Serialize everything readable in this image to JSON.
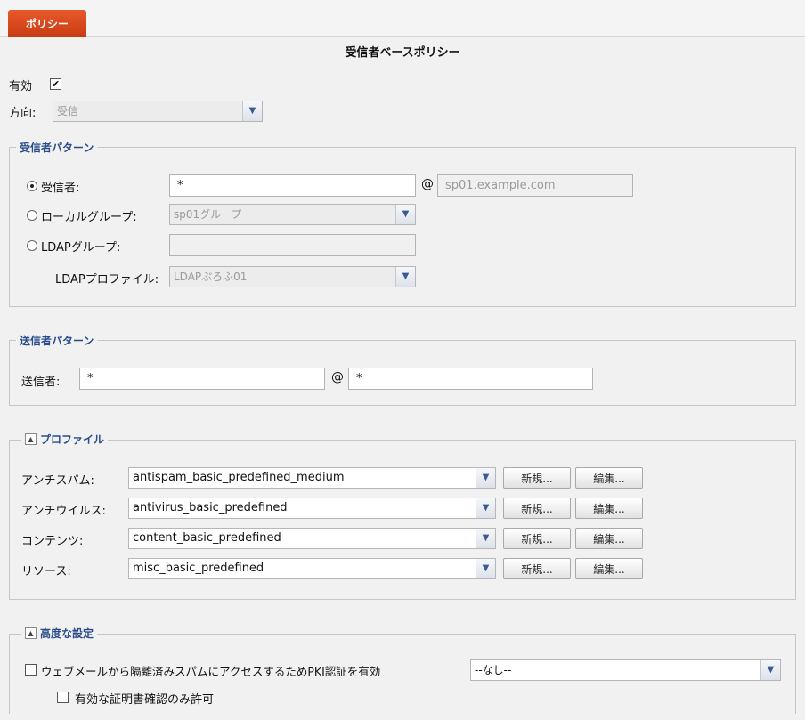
{
  "tab": {
    "label": "ポリシー"
  },
  "page": {
    "title": "受信者ベースポリシー"
  },
  "general": {
    "enable_label": "有効",
    "enable_checked": "✔",
    "direction_label": "方向:",
    "direction_value": "受信"
  },
  "recipient": {
    "legend": "受信者パターン",
    "recipient_label": "受信者:",
    "recipient_value": "*",
    "domain_value": "sp01.example.com",
    "local_group_label": "ローカルグループ:",
    "local_group_value": "sp01グループ",
    "ldap_group_label": "LDAPグループ:",
    "ldap_group_value": "",
    "ldap_profile_label": "LDAPプロファイル:",
    "ldap_profile_value": "LDAPぷろふ01",
    "at": "@"
  },
  "sender": {
    "legend": "送信者パターン",
    "sender_label": "送信者:",
    "sender_value": "*",
    "domain_value": "*",
    "at": "@"
  },
  "profile": {
    "legend": "プロファイル",
    "rows": [
      {
        "label": "アンチスパム:",
        "value": "antispam_basic_predefined_medium",
        "new": "新規...",
        "edit": "編集..."
      },
      {
        "label": "アンチウイルス:",
        "value": "antivirus_basic_predefined",
        "new": "新規...",
        "edit": "編集..."
      },
      {
        "label": "コンテンツ:",
        "value": "content_basic_predefined",
        "new": "新規...",
        "edit": "編集..."
      },
      {
        "label": "リソース:",
        "value": "misc_basic_predefined",
        "new": "新規...",
        "edit": "編集..."
      }
    ]
  },
  "advanced": {
    "legend": "高度な設定",
    "pki_label": "ウェブメールから隔離済みスパムにアクセスするためPKI認証を有効",
    "pki_value": "--なし--",
    "valid_cert_label": "有効な証明書確認のみ許可"
  },
  "icons": {
    "dropdown": "chevron-down-icon",
    "collapse": "collapse-up-icon"
  }
}
